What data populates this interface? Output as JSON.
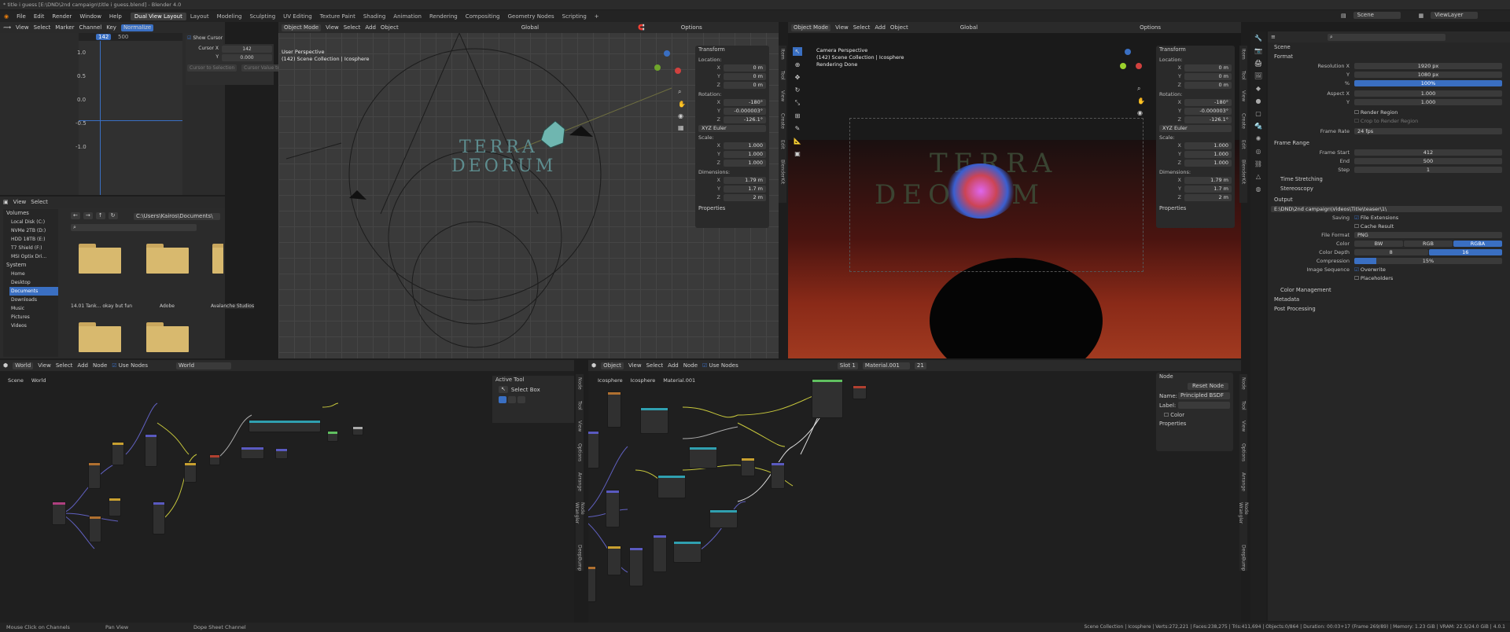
{
  "window": {
    "title": "* title i guess [E:\\DND\\2nd campaign\\title i guess.blend] - Blender 4.0"
  },
  "menu": {
    "items": [
      "File",
      "Edit",
      "Render",
      "Window",
      "Help"
    ],
    "workspaces": [
      "Dual View Layout",
      "Layout",
      "Modeling",
      "Sculpting",
      "UV Editing",
      "Texture Paint",
      "Shading",
      "Animation",
      "Rendering",
      "Compositing",
      "Geometry Nodes",
      "Scripting"
    ],
    "add_tab": "+"
  },
  "top_right": {
    "scene": "Scene",
    "view_layer": "ViewLayer"
  },
  "graph": {
    "menus": [
      "View",
      "Select",
      "Marker",
      "Channel",
      "Key"
    ],
    "normalize": "Normalize",
    "frame_current": "142",
    "frame_end": "500",
    "y_ticks": [
      "1.0",
      "0.5",
      "0.0",
      "-0.5",
      "-1.0"
    ],
    "cursor_panel": {
      "show_cursor": "Show Cursor",
      "cursor_x_label": "Cursor X",
      "cursor_x": "142",
      "y_label": "Y",
      "y": "0.000",
      "btn1": "Cursor to Selection",
      "btn2": "Cursor Value to Selection"
    }
  },
  "filebrowser": {
    "menus": [
      "View",
      "Select"
    ],
    "path": "C:\\Users\\Kairos\\Documents\\",
    "volumes_title": "Volumes",
    "volumes": [
      "Local Disk (C:)",
      "NVMe 2TB (D:)",
      "HDD 18TB (E:)",
      "T7 Shield (F:)",
      "MSI Optix Dri..."
    ],
    "system_title": "System",
    "system": [
      "Home",
      "Desktop",
      "Documents",
      "Downloads",
      "Music",
      "Pictures",
      "Videos"
    ],
    "folders": [
      "14.01 Tank... okay but fun",
      "Adobe",
      "Avalanche Studios",
      "",
      "",
      ""
    ]
  },
  "viewport_left": {
    "mode": "Object Mode",
    "menus": [
      "View",
      "Select",
      "Add",
      "Object"
    ],
    "orientation": "Global",
    "options": "Options",
    "perspective": "User Perspective",
    "collection": "(142) Scene Collection | Icosphere"
  },
  "viewport_right": {
    "mode": "Object Mode",
    "menus": [
      "View",
      "Select",
      "Add",
      "Object"
    ],
    "orientation": "Global",
    "options": "Options",
    "perspective": "Camera Perspective",
    "collection": "(142) Scene Collection | Icosphere",
    "status": "Rendering Done"
  },
  "transform": {
    "title": "Transform",
    "location_label": "Location:",
    "rotation_label": "Rotation:",
    "scale_label": "Scale:",
    "dimensions_label": "Dimensions:",
    "properties": "Properties",
    "loc": [
      [
        "X",
        "0 m"
      ],
      [
        "Y",
        "0 m"
      ],
      [
        "Z",
        "0 m"
      ]
    ],
    "rot": [
      [
        "X",
        "-180°"
      ],
      [
        "Y",
        "-0.000003°"
      ],
      [
        "Z",
        "-126.1°"
      ]
    ],
    "euler": "XYZ Euler",
    "scale": [
      [
        "X",
        "1.000"
      ],
      [
        "Y",
        "1.000"
      ],
      [
        "Z",
        "1.000"
      ]
    ],
    "dim": [
      [
        "X",
        "1.79 m"
      ],
      [
        "Y",
        "1.7 m"
      ],
      [
        "Z",
        "2 m"
      ]
    ]
  },
  "vtabs_left": [
    "Item",
    "Tool",
    "View",
    "Create",
    "Edit",
    "BlenderKit"
  ],
  "vtabs_right": [
    "Item",
    "Tool",
    "View",
    "Create",
    "Edit",
    "BlenderKit"
  ],
  "world_editor": {
    "type": "World",
    "menus": [
      "View",
      "Select",
      "Add",
      "Node"
    ],
    "use_nodes": "Use Nodes",
    "datablock": "World",
    "breadcrumb": [
      "Scene",
      "World"
    ],
    "active_tool": "Active Tool",
    "select_box": "Select Box",
    "vtabs": [
      "Node",
      "Tool",
      "View",
      "Options",
      "Arrange",
      "Node Wrangler",
      "DeepBump"
    ]
  },
  "shader_editor": {
    "type": "Object",
    "menus": [
      "View",
      "Select",
      "Add",
      "Node"
    ],
    "use_nodes": "Use Nodes",
    "slot": "Slot 1",
    "material": "Material.001",
    "users": "21",
    "breadcrumb": [
      "Icosphere",
      "Icosphere",
      "Material.001"
    ],
    "node_panel": {
      "title": "Node",
      "reset": "Reset Node",
      "name_label": "Name:",
      "name": "Principled BSDF",
      "label_label": "Label:",
      "color": "Color",
      "properties": "Properties"
    },
    "vtabs": [
      "Node",
      "Tool",
      "View",
      "Options",
      "Arrange",
      "Node Wrangler",
      "DeepBump"
    ]
  },
  "properties": {
    "scene": "Scene",
    "format": "Format",
    "res_x_label": "Resolution X",
    "res_x": "1920 px",
    "res_y_label": "Y",
    "res_y": "1080 px",
    "res_pct_label": "%",
    "res_pct": "100%",
    "aspect_x_label": "Aspect X",
    "aspect_x": "1.000",
    "aspect_y_label": "Y",
    "aspect_y": "1.000",
    "render_region": "Render Region",
    "crop": "Crop to Render Region",
    "frame_rate_label": "Frame Rate",
    "frame_rate": "24 fps",
    "frame_range": "Frame Range",
    "start_label": "Frame Start",
    "start": "412",
    "end_label": "End",
    "end": "500",
    "step_label": "Step",
    "step": "1",
    "time_stretching": "Time Stretching",
    "stereoscopy": "Stereoscopy",
    "output": "Output",
    "output_path": "E:\\DND\\2nd campaign\\Videos\\Title\\teaser\\1\\",
    "saving_label": "Saving",
    "file_ext": "File Extensions",
    "cache": "Cache Result",
    "file_format_label": "File Format",
    "file_format": "PNG",
    "color_label": "Color",
    "color_opts": [
      "BW",
      "RGB",
      "RGBA"
    ],
    "depth_label": "Color Depth",
    "depth_opts": [
      "8",
      "16"
    ],
    "compression_label": "Compression",
    "compression": "15%",
    "compression_fraction": 0.15,
    "image_seq_label": "Image Sequence",
    "overwrite": "Overwrite",
    "placeholders": "Placeholders",
    "color_mgmt": "Color Management",
    "metadata": "Metadata",
    "post": "Post Processing"
  },
  "viewport_text": {
    "line1": "TERRA",
    "line2": "DEORUM"
  },
  "statusbar": {
    "left1": "Mouse Click on Channels",
    "left2": "Pan View",
    "left3": "Dope Sheet Channel",
    "right": "Scene Collection | Icosphere | Verts:272,221 | Faces:238,275 | Tris:411,694 | Objects:0/864 | Duration: 00:03+17 (Frame 269/89) | Memory: 1.23 GiB | VRAM: 22.5/24.0 GiB | 4.0.1"
  }
}
